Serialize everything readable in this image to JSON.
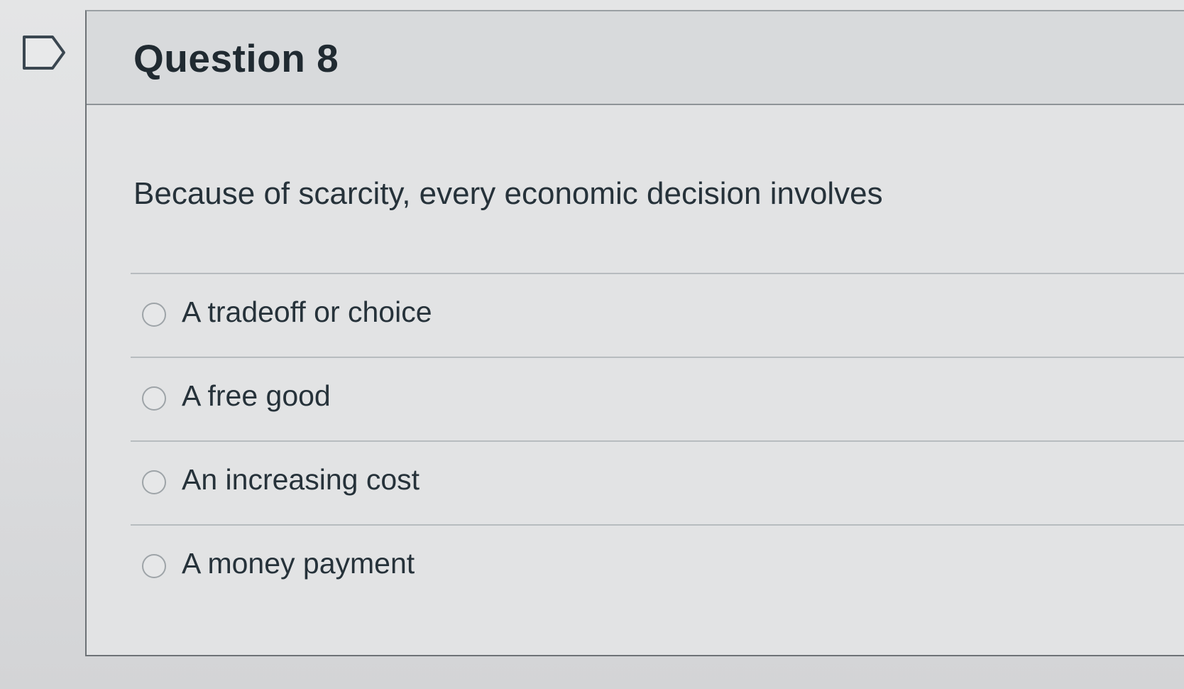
{
  "question": {
    "title": "Question 8",
    "flag_icon": "flag-outline-icon",
    "text": "Because of scarcity, every economic decision involves",
    "answers": [
      {
        "label": "A tradeoff or choice",
        "selected": false
      },
      {
        "label": "A free good",
        "selected": false
      },
      {
        "label": "An increasing cost",
        "selected": false
      },
      {
        "label": "A money payment",
        "selected": false
      }
    ]
  },
  "colors": {
    "page_background": "#d9dadb",
    "header_background": "#d8dadc",
    "text": "#26323a",
    "border": "#8e9498"
  }
}
